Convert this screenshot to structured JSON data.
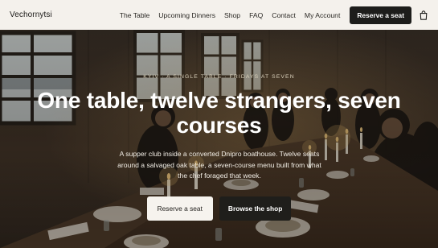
{
  "header": {
    "logo": "Vechornytsi",
    "nav": [
      {
        "label": "The Table"
      },
      {
        "label": "Upcoming Dinners"
      },
      {
        "label": "Shop"
      },
      {
        "label": "FAQ"
      },
      {
        "label": "Contact"
      },
      {
        "label": "My Account"
      }
    ],
    "reserve_label": "Reserve a seat",
    "cart_icon": "shopping-bag-icon"
  },
  "hero": {
    "eyebrow": "Kyiv · A single table · Fridays at seven",
    "headline": "One table, twelve strangers, seven courses",
    "subtext": "A supper club inside a converted Dnipro boathouse. Twelve seats around a salvaged oak table, a seven-course menu built from what the chef foraged that week.",
    "primary_cta": "Reserve a seat",
    "secondary_cta": "Browse the shop"
  },
  "colors": {
    "header_bg": "#f4f1ec",
    "dark_button": "#1d1d1b",
    "light_button": "#f6f3ee",
    "headline": "#ffffff"
  }
}
